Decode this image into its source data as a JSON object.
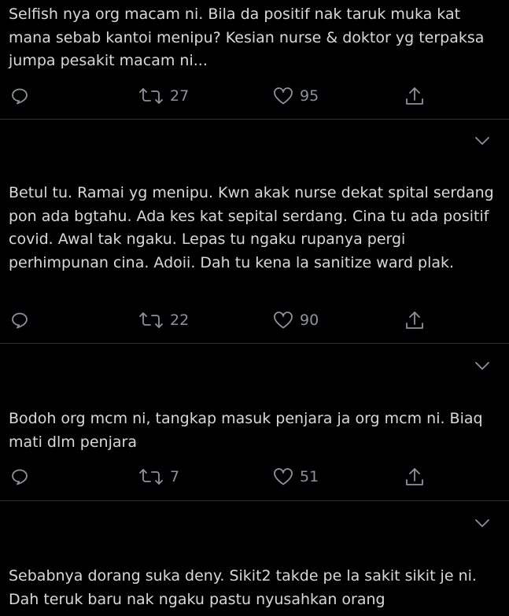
{
  "tweets": [
    {
      "text": "Selfish nya org macam ni. Bila da positif nak taruk muka kat mana sebab kantoi menipu? Kesian nurse & doktor yg terpaksa jumpa pesakit macam ni...",
      "retweets": "27",
      "likes": "95"
    },
    {
      "text": "Betul tu. Ramai yg menipu. Kwn akak nurse dekat spital serdang pon ada bgtahu. Ada kes kat sepital serdang. Cina tu ada positif covid. Awal tak ngaku. Lepas tu ngaku rupanya pergi perhimpunan cina. Adoii. Dah tu kena la sanitize ward plak.",
      "retweets": "22",
      "likes": "90"
    },
    {
      "text": "Bodoh org mcm ni, tangkap masuk penjara ja org mcm ni. Biaq mati dlm penjara",
      "retweets": "7",
      "likes": "51"
    },
    {
      "text": "Sebabnya dorang suka deny. Sikit2 takde pe la sakit sikit je ni. Dah teruk baru nak ngaku pastu nyusahkan orang"
    }
  ],
  "icons": {
    "reply": "reply-icon",
    "retweet": "retweet-icon",
    "like": "like-icon",
    "share": "share-icon",
    "more": "chevron-down-icon"
  },
  "colors": {
    "background": "#000000",
    "text": "#d9d9d9",
    "muted": "#8b949a",
    "divider": "#2f3336"
  }
}
